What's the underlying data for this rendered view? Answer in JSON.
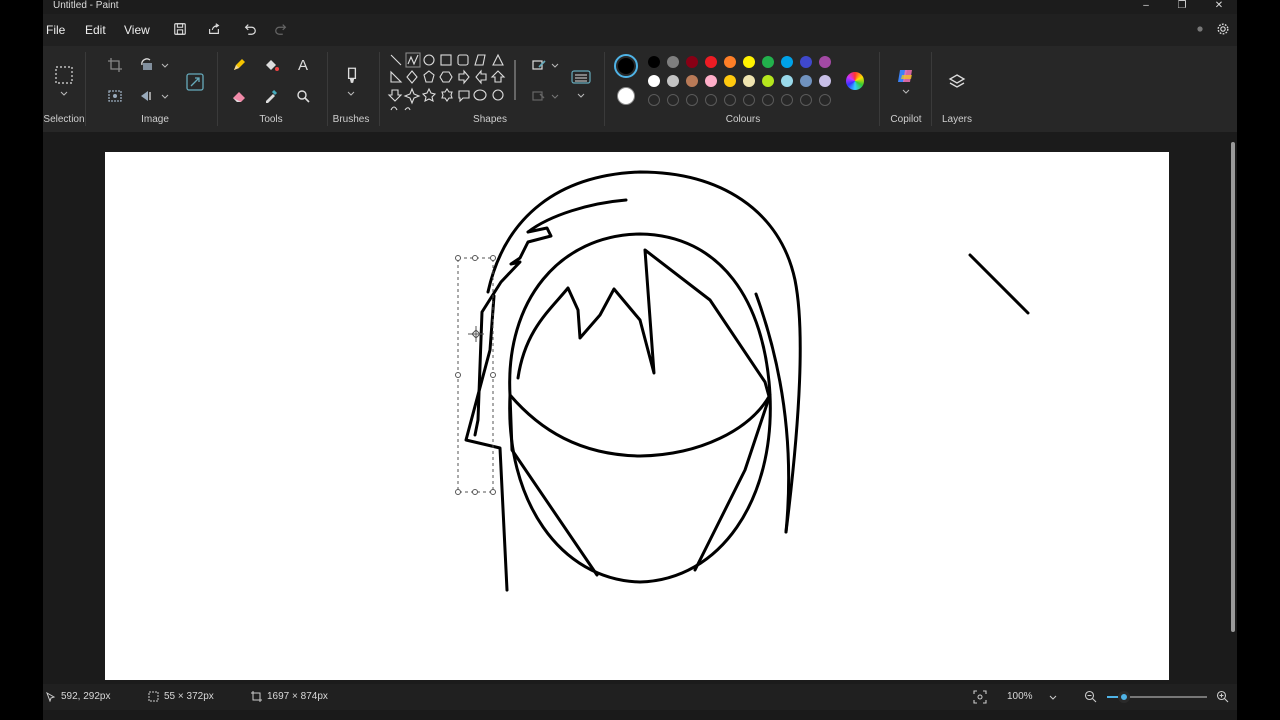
{
  "window": {
    "title": "Untitled - Paint"
  },
  "menu": {
    "file": "File",
    "edit": "Edit",
    "view": "View"
  },
  "ribbon": {
    "groups": {
      "selection": "Selection",
      "image": "Image",
      "tools": "Tools",
      "brushes": "Brushes",
      "shapes": "Shapes",
      "colours": "Colours",
      "copilot": "Copilot",
      "layers": "Layers"
    },
    "tools_text_glyph": "A",
    "colours": {
      "primary": "#000000",
      "secondary": "#ffffff",
      "row1": [
        "#000000",
        "#7f7f7f",
        "#880015",
        "#ed1c24",
        "#ff7f27",
        "#fff200",
        "#22b14c",
        "#00a2e8",
        "#3f48cc",
        "#a349a4"
      ],
      "row2": [
        "#ffffff",
        "#c3c3c3",
        "#b97a57",
        "#ffaec9",
        "#ffc90e",
        "#efe4b0",
        "#b5e61d",
        "#99d9ea",
        "#7092be",
        "#c8bfe7"
      ]
    }
  },
  "status": {
    "cursor_pos": "592, 292px",
    "selection_size": "55 × 372px",
    "canvas_size": "1697 × 874px",
    "zoom": "100%"
  }
}
